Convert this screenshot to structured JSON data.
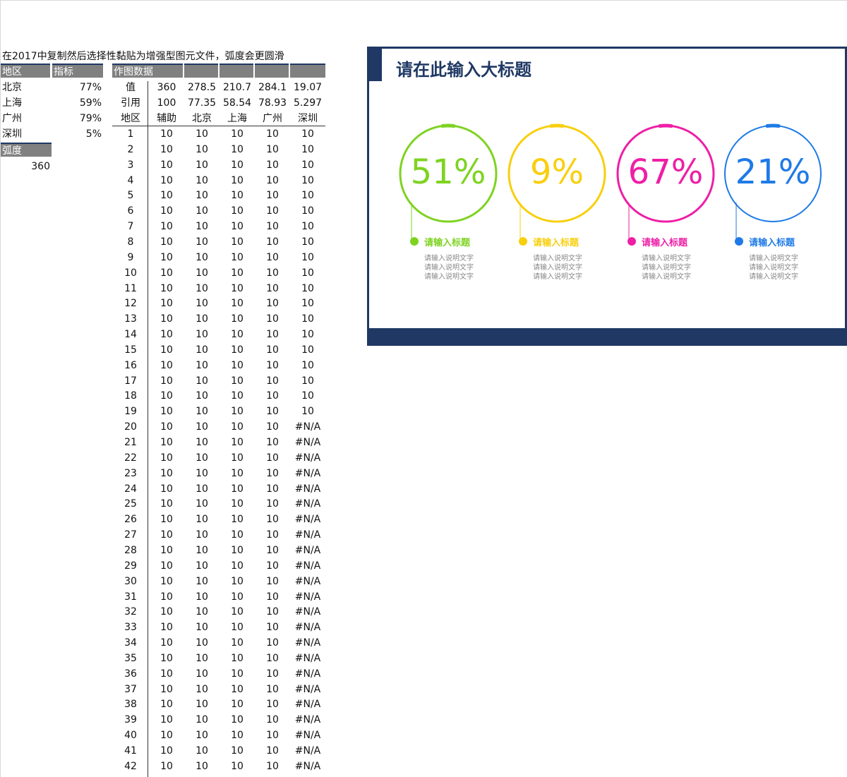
{
  "note": "在2017中复制然后选择性黏贴为增强型图元文件，弧度会更圆滑",
  "left_table": {
    "headers": [
      "地区",
      "指标"
    ],
    "rows": [
      {
        "region": "北京",
        "value": "77%"
      },
      {
        "region": "上海",
        "value": "59%"
      },
      {
        "region": "广州",
        "value": "79%"
      },
      {
        "region": "深圳",
        "value": "5%"
      }
    ],
    "radian_label": "弧度",
    "radian_value": "360"
  },
  "chart_data_table": {
    "header": "作图数据",
    "row_value": [
      "值",
      "360",
      "278.5",
      "210.7",
      "284.1",
      "19.07"
    ],
    "row_ref": [
      "引用",
      "100",
      "77.35",
      "58.54",
      "78.93",
      "5.297"
    ],
    "col_headers": [
      "地区",
      "辅助",
      "北京",
      "上海",
      "广州",
      "深圳"
    ],
    "rows": [
      [
        "1",
        "10",
        "10",
        "10",
        "10",
        "10"
      ],
      [
        "2",
        "10",
        "10",
        "10",
        "10",
        "10"
      ],
      [
        "3",
        "10",
        "10",
        "10",
        "10",
        "10"
      ],
      [
        "4",
        "10",
        "10",
        "10",
        "10",
        "10"
      ],
      [
        "5",
        "10",
        "10",
        "10",
        "10",
        "10"
      ],
      [
        "6",
        "10",
        "10",
        "10",
        "10",
        "10"
      ],
      [
        "7",
        "10",
        "10",
        "10",
        "10",
        "10"
      ],
      [
        "8",
        "10",
        "10",
        "10",
        "10",
        "10"
      ],
      [
        "9",
        "10",
        "10",
        "10",
        "10",
        "10"
      ],
      [
        "10",
        "10",
        "10",
        "10",
        "10",
        "10"
      ],
      [
        "11",
        "10",
        "10",
        "10",
        "10",
        "10"
      ],
      [
        "12",
        "10",
        "10",
        "10",
        "10",
        "10"
      ],
      [
        "13",
        "10",
        "10",
        "10",
        "10",
        "10"
      ],
      [
        "14",
        "10",
        "10",
        "10",
        "10",
        "10"
      ],
      [
        "15",
        "10",
        "10",
        "10",
        "10",
        "10"
      ],
      [
        "16",
        "10",
        "10",
        "10",
        "10",
        "10"
      ],
      [
        "17",
        "10",
        "10",
        "10",
        "10",
        "10"
      ],
      [
        "18",
        "10",
        "10",
        "10",
        "10",
        "10"
      ],
      [
        "19",
        "10",
        "10",
        "10",
        "10",
        "10"
      ],
      [
        "20",
        "10",
        "10",
        "10",
        "10",
        "#N/A"
      ],
      [
        "21",
        "10",
        "10",
        "10",
        "10",
        "#N/A"
      ],
      [
        "22",
        "10",
        "10",
        "10",
        "10",
        "#N/A"
      ],
      [
        "23",
        "10",
        "10",
        "10",
        "10",
        "#N/A"
      ],
      [
        "24",
        "10",
        "10",
        "10",
        "10",
        "#N/A"
      ],
      [
        "25",
        "10",
        "10",
        "10",
        "10",
        "#N/A"
      ],
      [
        "26",
        "10",
        "10",
        "10",
        "10",
        "#N/A"
      ],
      [
        "27",
        "10",
        "10",
        "10",
        "10",
        "#N/A"
      ],
      [
        "28",
        "10",
        "10",
        "10",
        "10",
        "#N/A"
      ],
      [
        "29",
        "10",
        "10",
        "10",
        "10",
        "#N/A"
      ],
      [
        "30",
        "10",
        "10",
        "10",
        "10",
        "#N/A"
      ],
      [
        "31",
        "10",
        "10",
        "10",
        "10",
        "#N/A"
      ],
      [
        "32",
        "10",
        "10",
        "10",
        "10",
        "#N/A"
      ],
      [
        "33",
        "10",
        "10",
        "10",
        "10",
        "#N/A"
      ],
      [
        "34",
        "10",
        "10",
        "10",
        "10",
        "#N/A"
      ],
      [
        "35",
        "10",
        "10",
        "10",
        "10",
        "#N/A"
      ],
      [
        "36",
        "10",
        "10",
        "10",
        "10",
        "#N/A"
      ],
      [
        "37",
        "10",
        "10",
        "10",
        "10",
        "#N/A"
      ],
      [
        "38",
        "10",
        "10",
        "10",
        "10",
        "#N/A"
      ],
      [
        "39",
        "10",
        "10",
        "10",
        "10",
        "#N/A"
      ],
      [
        "40",
        "10",
        "10",
        "10",
        "10",
        "#N/A"
      ],
      [
        "41",
        "10",
        "10",
        "10",
        "10",
        "#N/A"
      ],
      [
        "42",
        "10",
        "10",
        "10",
        "10",
        "#N/A"
      ]
    ]
  },
  "card": {
    "title": "请在此输入大标题",
    "accent_color": "#1f3864",
    "items": [
      {
        "pct": "51%",
        "title": "请输入标题",
        "desc": [
          "请输入说明文字",
          "请输入说明文字",
          "请输入说明文字"
        ],
        "color": "#7ed321"
      },
      {
        "pct": "9%",
        "title": "请输入标题",
        "desc": [
          "请输入说明文字",
          "请输入说明文字",
          "请输入说明文字"
        ],
        "color": "#f8cf0e"
      },
      {
        "pct": "67%",
        "title": "请输入标题",
        "desc": [
          "请输入说明文字",
          "请输入说明文字",
          "请输入说明文字"
        ],
        "color": "#ee1fa6"
      },
      {
        "pct": "21%",
        "title": "请输入标题",
        "desc": [
          "请输入说明文字",
          "请输入说明文字",
          "请输入说明文字"
        ],
        "color": "#1e7ae6"
      }
    ]
  }
}
